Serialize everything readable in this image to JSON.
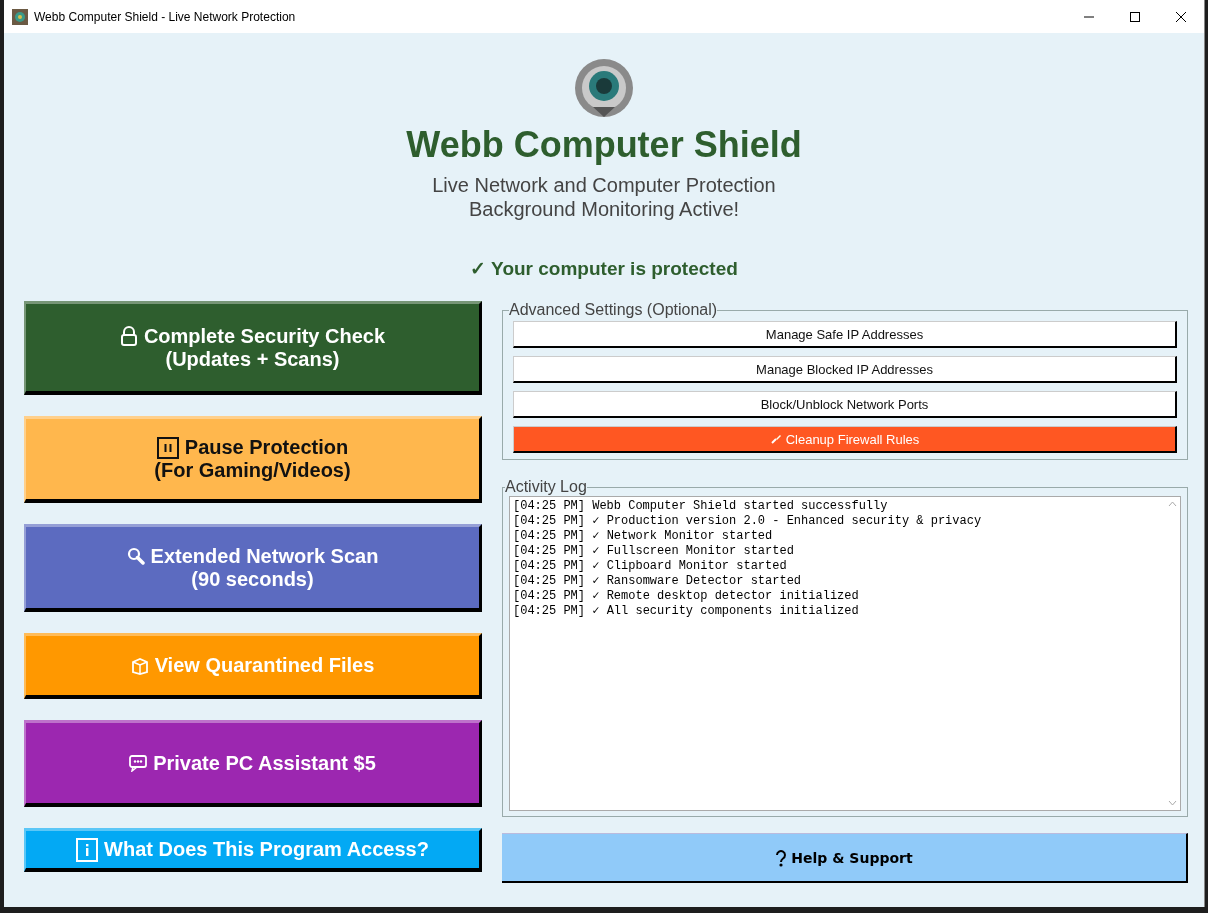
{
  "window": {
    "title": "Webb Computer Shield - Live Network Protection"
  },
  "header": {
    "title": "Webb Computer Shield",
    "subtitle_lines": [
      "Live Network and Computer Protection",
      "Background Monitoring Active!"
    ],
    "status": "✓ Your computer is protected"
  },
  "main_buttons": [
    {
      "kind": "lock",
      "lines": [
        "Complete Security Check",
        "(Updates + Scans)"
      ],
      "color": "#2e5e2e"
    },
    {
      "kind": "pause",
      "lines": [
        "Pause Protection",
        "(For Gaming/Videos)"
      ],
      "color": "#ffb74d"
    },
    {
      "kind": "search",
      "lines": [
        "Extended Network Scan",
        "(90 seconds)"
      ],
      "color": "#5c6bc0"
    },
    {
      "kind": "files",
      "lines": [
        "View Quarantined Files"
      ],
      "color": "#ff9800"
    },
    {
      "kind": "chat",
      "lines": [
        "Private PC Assistant $5"
      ],
      "color": "#9c27b0"
    },
    {
      "kind": "info",
      "lines": [
        "What Does This Program Access?"
      ],
      "color": "#03a9f4"
    }
  ],
  "advanced_settings": {
    "title": "Advanced Settings (Optional)",
    "buttons": [
      {
        "kind": "plain",
        "label": "Manage Safe IP Addresses"
      },
      {
        "kind": "plain",
        "label": "Manage Blocked IP Addresses"
      },
      {
        "kind": "plain",
        "label": "Block/Unblock Network Ports"
      },
      {
        "kind": "danger",
        "label": "Cleanup Firewall Rules"
      }
    ]
  },
  "activity_log": {
    "title": "Activity Log",
    "lines": [
      "[04:25 PM] Webb Computer Shield started successfully",
      "[04:25 PM] ✓ Production version 2.0 - Enhanced security & privacy",
      "[04:25 PM] ✓ Network Monitor started",
      "[04:25 PM] ✓ Fullscreen Monitor started",
      "[04:25 PM] ✓ Clipboard Monitor started",
      "[04:25 PM] ✓ Ransomware Detector started",
      "[04:25 PM] ✓ Remote desktop detector initialized",
      "[04:25 PM] ✓ All security components initialized"
    ]
  },
  "help_button": {
    "label": "Help & Support"
  }
}
